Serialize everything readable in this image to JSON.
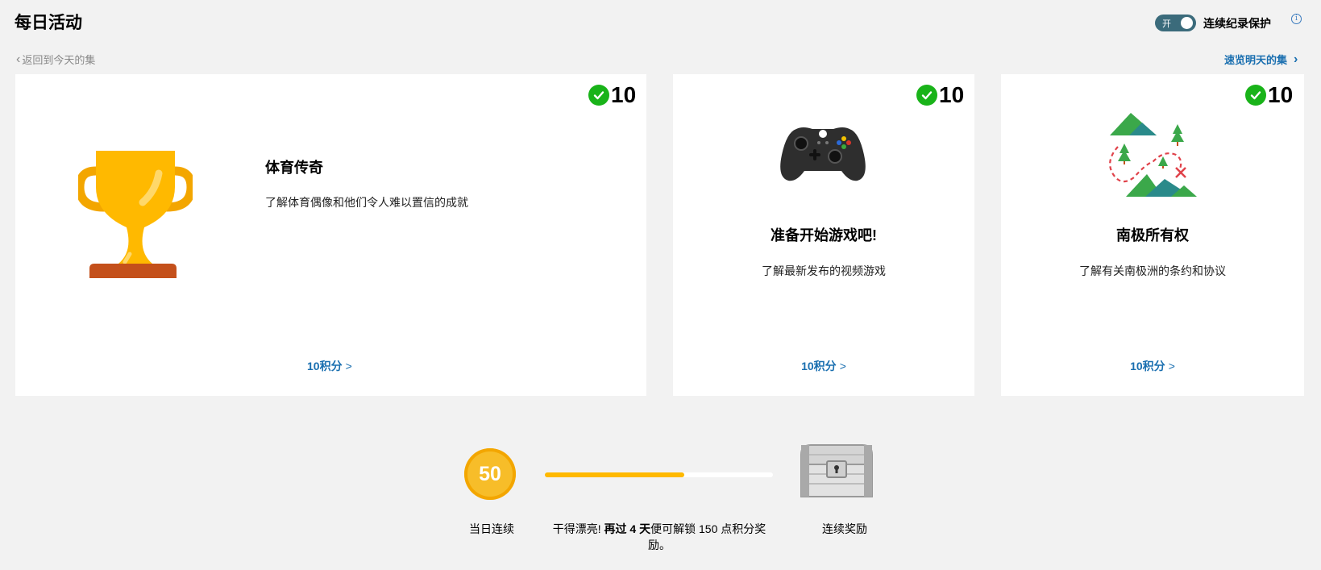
{
  "header": {
    "title": "每日活动",
    "toggle_state": "开",
    "toggle_label": "连续纪录保护",
    "info_icon": "i"
  },
  "nav": {
    "back": "返回到今天的集",
    "next": "速览明天的集"
  },
  "cards": [
    {
      "points": "10",
      "icon": "trophy-icon",
      "title": "体育传奇",
      "description": "了解体育偶像和他们令人难以置信的成就",
      "link": "10积分",
      "link_arrow": ">"
    },
    {
      "points": "10",
      "icon": "game-controller-icon",
      "title": "准备开始游戏吧!",
      "description": "了解最新发布的视频游戏",
      "link": "10积分",
      "link_arrow": ">"
    },
    {
      "points": "10",
      "icon": "treasure-map-icon",
      "title": "南极所有权",
      "description": "了解有关南极洲的条约和协议",
      "link": "10积分",
      "link_arrow": ">"
    }
  ],
  "streak": {
    "value": "50",
    "label": "当日连续",
    "progress_fraction": 0.61,
    "msg_prefix": "干得漂亮! ",
    "msg_bold": "再过 4 天",
    "msg_suffix": "便可解锁 150 点积分奖励。",
    "reward_label": "连续奖励",
    "reward_icon": "treasure-chest-icon"
  },
  "colors": {
    "accent": "#1a6fb0",
    "check": "#19b319",
    "toggle": "#3b6b7b",
    "streak": "#f7bd29",
    "progress": "#ffb900"
  }
}
